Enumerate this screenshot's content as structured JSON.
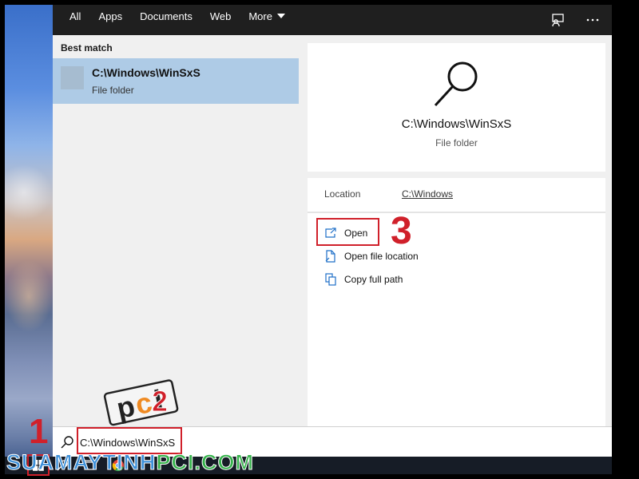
{
  "nav": {
    "tabs": [
      "All",
      "Apps",
      "Documents",
      "Web",
      "More"
    ],
    "icons": [
      "feedback-icon",
      "more-options-icon"
    ]
  },
  "results": {
    "section_label": "Best match",
    "best_match": {
      "title": "C:\\Windows\\WinSxS",
      "subtitle": "File folder",
      "icon": "folder-icon"
    }
  },
  "preview": {
    "icon": "search-magnifier-icon",
    "title": "C:\\Windows\\WinSxS",
    "subtitle": "File folder",
    "location_label": "Location",
    "location_value": "C:\\Windows",
    "actions": [
      {
        "label": "Open",
        "icon": "open-icon"
      },
      {
        "label": "Open file location",
        "icon": "file-location-icon"
      },
      {
        "label": "Copy full path",
        "icon": "copy-icon"
      }
    ]
  },
  "search": {
    "value": "C:\\Windows\\WinSxS",
    "icon": "search-icon"
  },
  "annotations": {
    "step1": "1",
    "step2": "2",
    "step3": "3",
    "color": "#d0202a"
  },
  "watermark": {
    "part1": "SUAMAYTINH",
    "part2": "PCI",
    "part3": ".COM",
    "logo_text": "pci"
  },
  "colors": {
    "selected": "#aecbe6",
    "nav_bg": "#1f1f1f",
    "taskbar_bg": "#161c26"
  }
}
